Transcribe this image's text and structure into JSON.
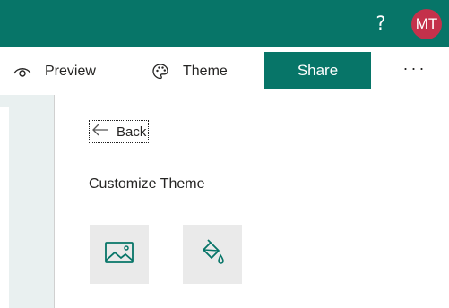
{
  "header": {
    "help_label": "?",
    "avatar_initials": "MT",
    "brand_color": "#077568",
    "avatar_color": "#c4314b"
  },
  "commands": {
    "preview_label": "Preview",
    "theme_label": "Theme",
    "share_label": "Share",
    "more_label": "···"
  },
  "panel": {
    "back_label": "Back",
    "title": "Customize Theme",
    "tiles": [
      {
        "icon": "image-icon"
      },
      {
        "icon": "paint-bucket-icon"
      }
    ]
  }
}
